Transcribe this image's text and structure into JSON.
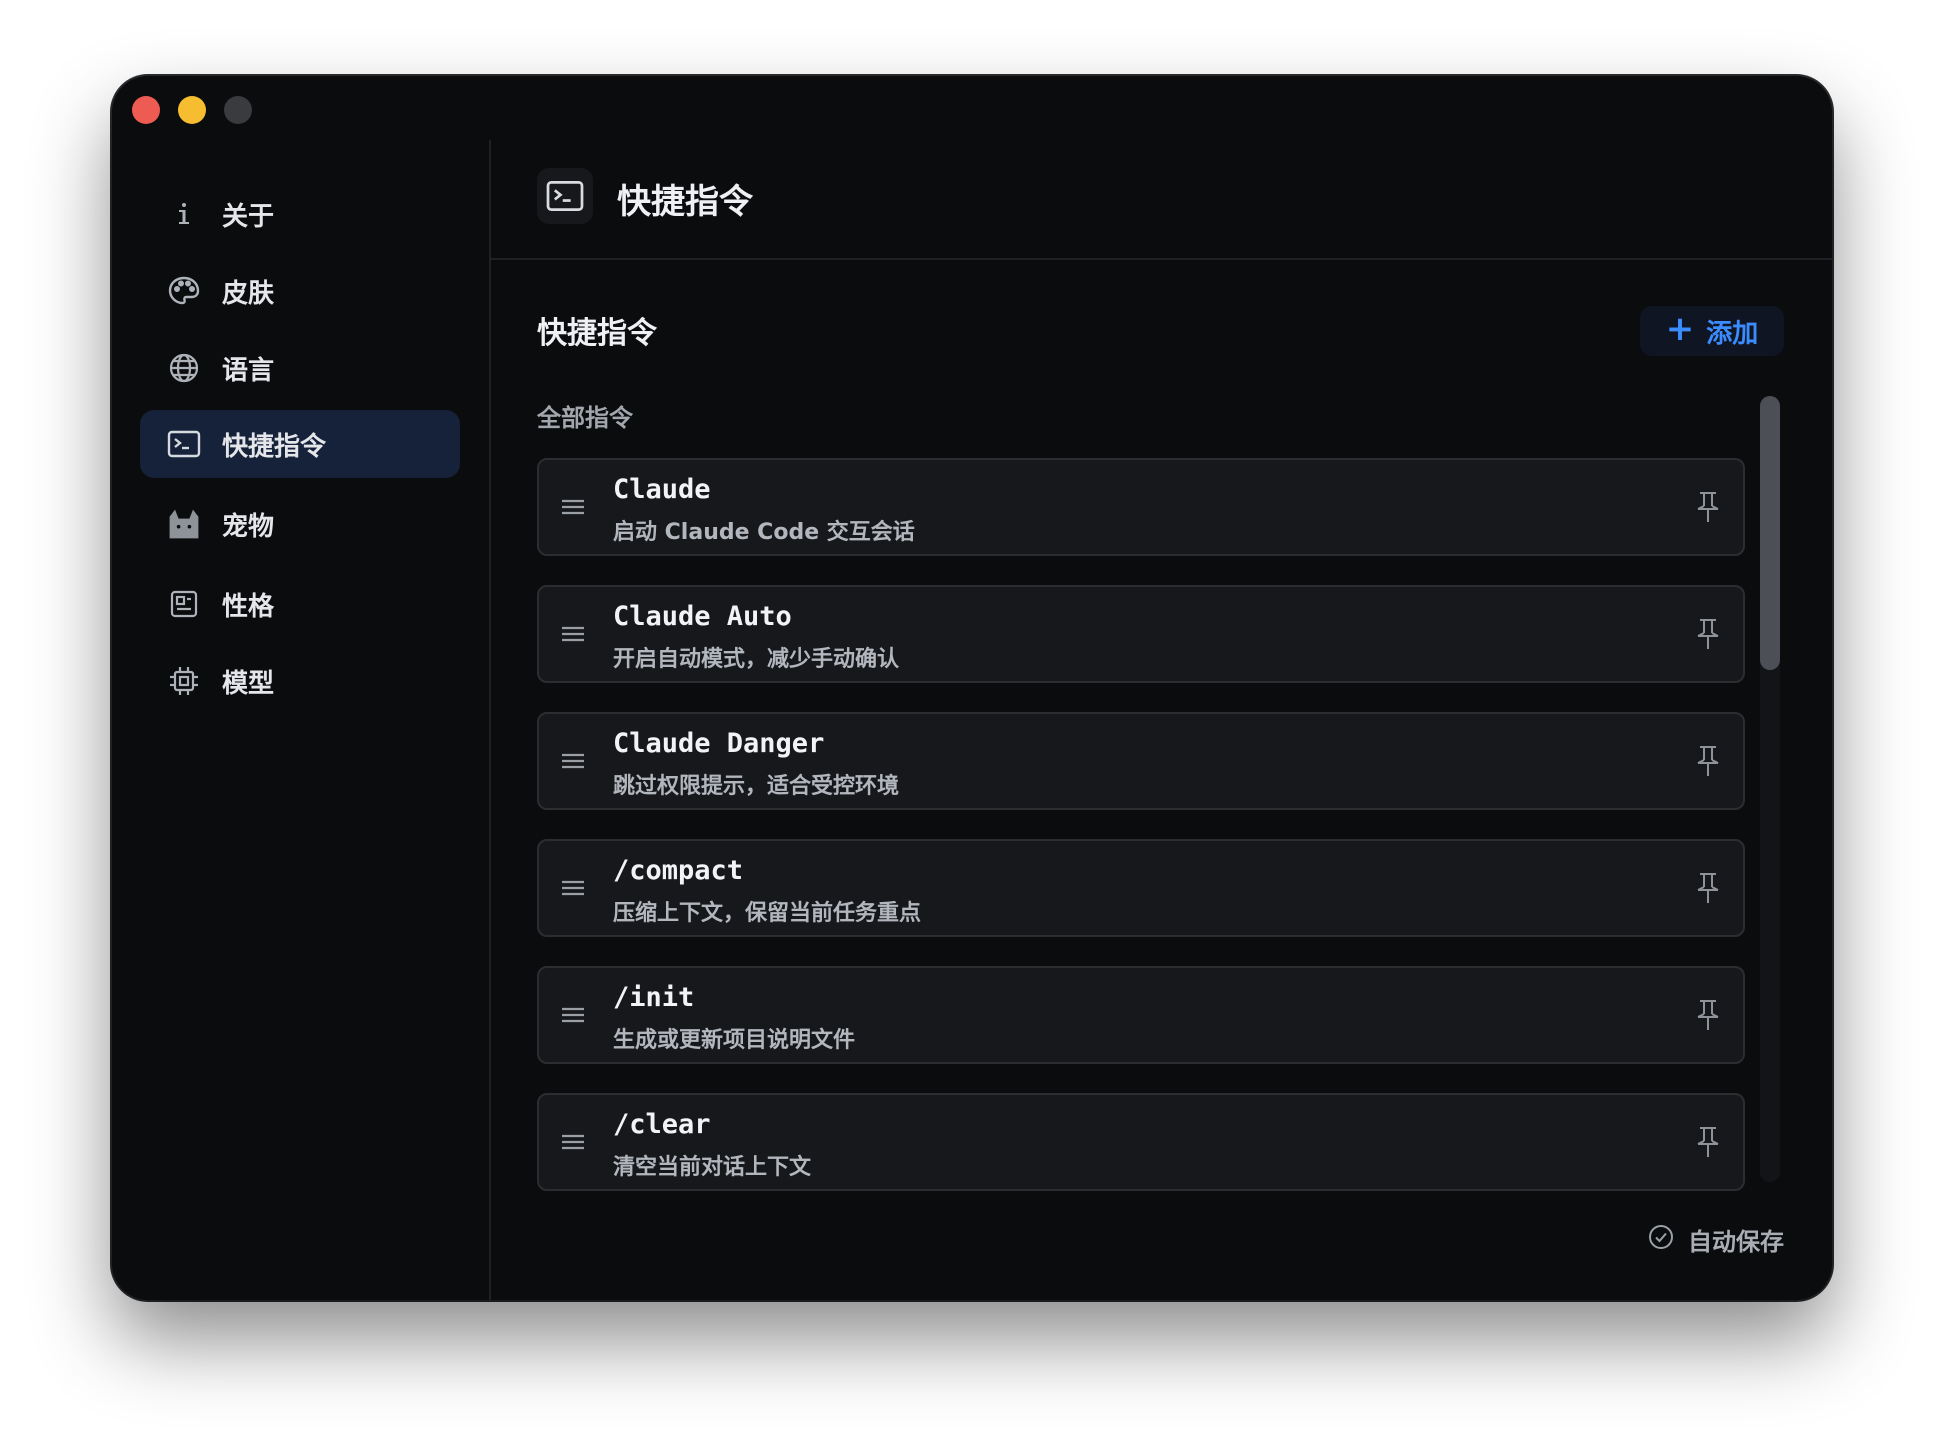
{
  "window": {
    "controls": [
      "close",
      "minimize",
      "zoom"
    ]
  },
  "sidebar": {
    "items": [
      {
        "label": "关于",
        "icon": "info-icon",
        "active": false
      },
      {
        "label": "皮肤",
        "icon": "palette-icon",
        "active": false
      },
      {
        "label": "语言",
        "icon": "globe-icon",
        "active": false
      },
      {
        "label": "快捷指令",
        "icon": "terminal-icon",
        "active": true
      },
      {
        "label": "宠物",
        "icon": "cat-icon",
        "active": false
      },
      {
        "label": "性格",
        "icon": "profile-card-icon",
        "active": false
      },
      {
        "label": "模型",
        "icon": "chip-icon",
        "active": false
      }
    ]
  },
  "header": {
    "title": "快捷指令",
    "icon": "terminal-icon"
  },
  "section": {
    "title": "快捷指令",
    "add_label": "添加",
    "group_label": "全部指令"
  },
  "commands": [
    {
      "name": "Claude",
      "description": "启动 Claude Code 交互会话"
    },
    {
      "name": "Claude Auto",
      "description": "开启自动模式，减少手动确认"
    },
    {
      "name": "Claude Danger",
      "description": "跳过权限提示，适合受控环境"
    },
    {
      "name": "/compact",
      "description": "压缩上下文，保留当前任务重点"
    },
    {
      "name": "/init",
      "description": "生成或更新项目说明文件"
    },
    {
      "name": "/clear",
      "description": "清空当前对话上下文"
    }
  ],
  "footer": {
    "autosave_label": "自动保存",
    "autosave_icon": "check-circle-icon"
  },
  "colors": {
    "accent": "#3b8cff",
    "active_nav_bg": "#16223a",
    "window_bg": "#0b0c0e"
  }
}
